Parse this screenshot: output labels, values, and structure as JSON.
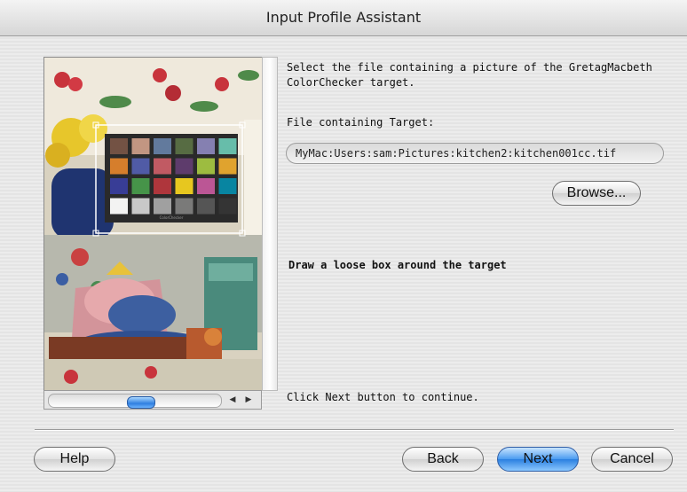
{
  "window": {
    "title": "Input Profile Assistant"
  },
  "panel": {
    "instruction_line1": "Select the file containing a picture of the GretagMacbeth",
    "instruction_line2": "ColorChecker target.",
    "file_label": "File containing Target:",
    "file_path": "MyMac:Users:sam:Pictures:kitchen2:kitchen001cc.tif",
    "browse_label": "Browse...",
    "draw_hint": "Draw a loose box around the target",
    "continue_hint": "Click Next button to continue."
  },
  "buttons": {
    "help": "Help",
    "back": "Back",
    "next": "Next",
    "cancel": "Cancel"
  },
  "icons": {
    "scroll_left": "scroll-left-arrow-icon",
    "scroll_right": "scroll-right-arrow-icon"
  },
  "colorchecker_swatches": [
    "#735244",
    "#c29682",
    "#627a9d",
    "#576c43",
    "#8580b1",
    "#67bdaa",
    "#d67e2c",
    "#505ba6",
    "#c15a63",
    "#5e3c6c",
    "#9dbc40",
    "#e0a32e",
    "#383d96",
    "#469449",
    "#af363c",
    "#e7c71f",
    "#bb5695",
    "#0885a1",
    "#f3f3f2",
    "#c8c8c8",
    "#a0a0a0",
    "#7a7a79",
    "#555555",
    "#343434"
  ]
}
